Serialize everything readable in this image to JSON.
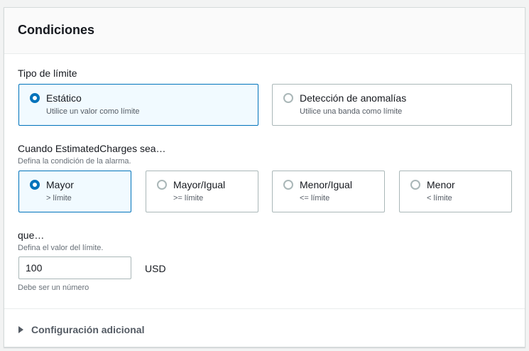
{
  "panel": {
    "title": "Condiciones"
  },
  "threshold_type": {
    "label": "Tipo de límite",
    "options": [
      {
        "label": "Estático",
        "description": "Utilice un valor como límite",
        "selected": true
      },
      {
        "label": "Detección de anomalías",
        "description": "Utilice una banda como límite",
        "selected": false
      }
    ]
  },
  "condition": {
    "label": "Cuando EstimatedCharges sea…",
    "description": "Defina la condición de la alarma.",
    "options": [
      {
        "label": "Mayor",
        "description": "> límite",
        "selected": true
      },
      {
        "label": "Mayor/Igual",
        "description": ">= límite",
        "selected": false
      },
      {
        "label": "Menor/Igual",
        "description": "<= límite",
        "selected": false
      },
      {
        "label": "Menor",
        "description": "< límite",
        "selected": false
      }
    ]
  },
  "threshold_value": {
    "label": "que…",
    "description": "Defina el valor del límite.",
    "value": "100",
    "unit": "USD",
    "constraint": "Debe ser un número"
  },
  "additional": {
    "label": "Configuración adicional",
    "expanded": false
  },
  "colors": {
    "accent": "#0073bb",
    "selected_bg": "#f1faff",
    "border": "#aab7b8"
  }
}
